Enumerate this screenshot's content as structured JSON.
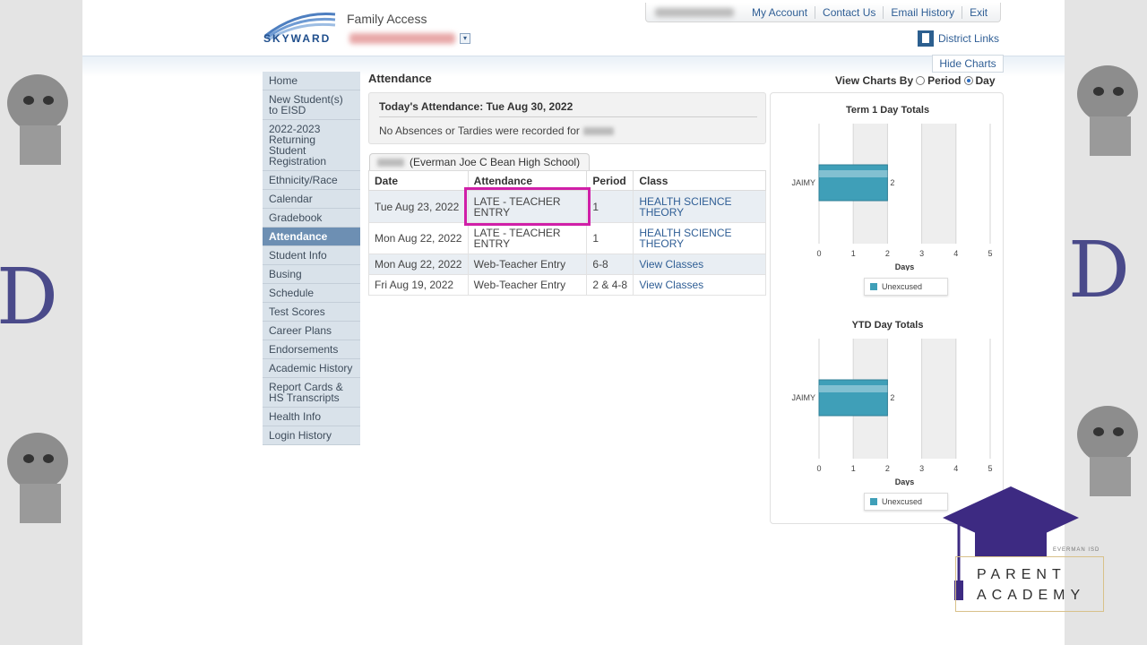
{
  "header": {
    "app_title": "Family Access",
    "logo_text": "SKYWARD",
    "toplinks": [
      "My Account",
      "Contact Us",
      "Email History",
      "Exit"
    ],
    "district_links": "District Links",
    "hide_charts": "Hide Charts"
  },
  "sidebar": {
    "items": [
      {
        "label": "Home"
      },
      {
        "label": "New Student(s) to EISD"
      },
      {
        "label": "2022-2023 Returning Student Registration"
      },
      {
        "label": "Ethnicity/Race"
      },
      {
        "label": "Calendar"
      },
      {
        "label": "Gradebook"
      },
      {
        "label": "Attendance",
        "active": true
      },
      {
        "label": "Student Info"
      },
      {
        "label": "Busing"
      },
      {
        "label": "Schedule"
      },
      {
        "label": "Test Scores"
      },
      {
        "label": "Career Plans"
      },
      {
        "label": "Endorsements"
      },
      {
        "label": "Academic History"
      },
      {
        "label": "Report Cards & HS Transcripts"
      },
      {
        "label": "Health Info"
      },
      {
        "label": "Login History"
      }
    ]
  },
  "main": {
    "title": "Attendance",
    "view_charts_by": "View Charts By",
    "view_options": [
      "Period",
      "Day"
    ],
    "view_selected": "Day",
    "today_heading": "Today's Attendance: Tue Aug 30, 2022",
    "today_message": "No Absences or Tardies were recorded for",
    "school_tab": "(Everman Joe C Bean High School)",
    "table": {
      "headers": [
        "Date",
        "Attendance",
        "Period",
        "Class"
      ],
      "rows": [
        {
          "date": "Tue Aug 23, 2022",
          "attendance": "LATE - TEACHER ENTRY",
          "period": "1",
          "class": "HEALTH SCIENCE THEORY"
        },
        {
          "date": "Mon Aug 22, 2022",
          "attendance": "LATE - TEACHER ENTRY",
          "period": "1",
          "class": "HEALTH SCIENCE THEORY"
        },
        {
          "date": "Mon Aug 22, 2022",
          "attendance": "Web-Teacher Entry",
          "period": "6-8",
          "class": "View Classes"
        },
        {
          "date": "Fri Aug 19, 2022",
          "attendance": "Web-Teacher Entry",
          "period": "2 & 4-8",
          "class": "View Classes"
        }
      ]
    }
  },
  "chart_data": [
    {
      "type": "bar",
      "orientation": "horizontal",
      "title": "Term 1 Day Totals",
      "categories": [
        "JAIMY"
      ],
      "series": [
        {
          "name": "Unexcused",
          "values": [
            2
          ]
        }
      ],
      "data_labels": [
        "2"
      ],
      "xlabel": "Days",
      "xlim": [
        0,
        5
      ],
      "ticks": [
        "0",
        "1",
        "2",
        "3",
        "4",
        "5"
      ],
      "legend": "bottom"
    },
    {
      "type": "bar",
      "orientation": "horizontal",
      "title": "YTD Day Totals",
      "categories": [
        "JAIMY"
      ],
      "series": [
        {
          "name": "Unexcused",
          "values": [
            2
          ]
        }
      ],
      "data_labels": [
        "2"
      ],
      "xlabel": "Days",
      "xlim": [
        0,
        5
      ],
      "ticks": [
        "0",
        "1",
        "2",
        "3",
        "4",
        "5"
      ],
      "legend": "bottom"
    }
  ],
  "branding": {
    "line1": "PARENT",
    "line2": "ACADEMY",
    "small": "EVERMAN ISD",
    "side_letter": "D"
  },
  "colors": {
    "highlight": "#d01fa8",
    "bar": "#3f9fb8",
    "sidebar_active": "#6d8fb3",
    "link": "#2f5e95",
    "cap": "#3d2a82"
  }
}
